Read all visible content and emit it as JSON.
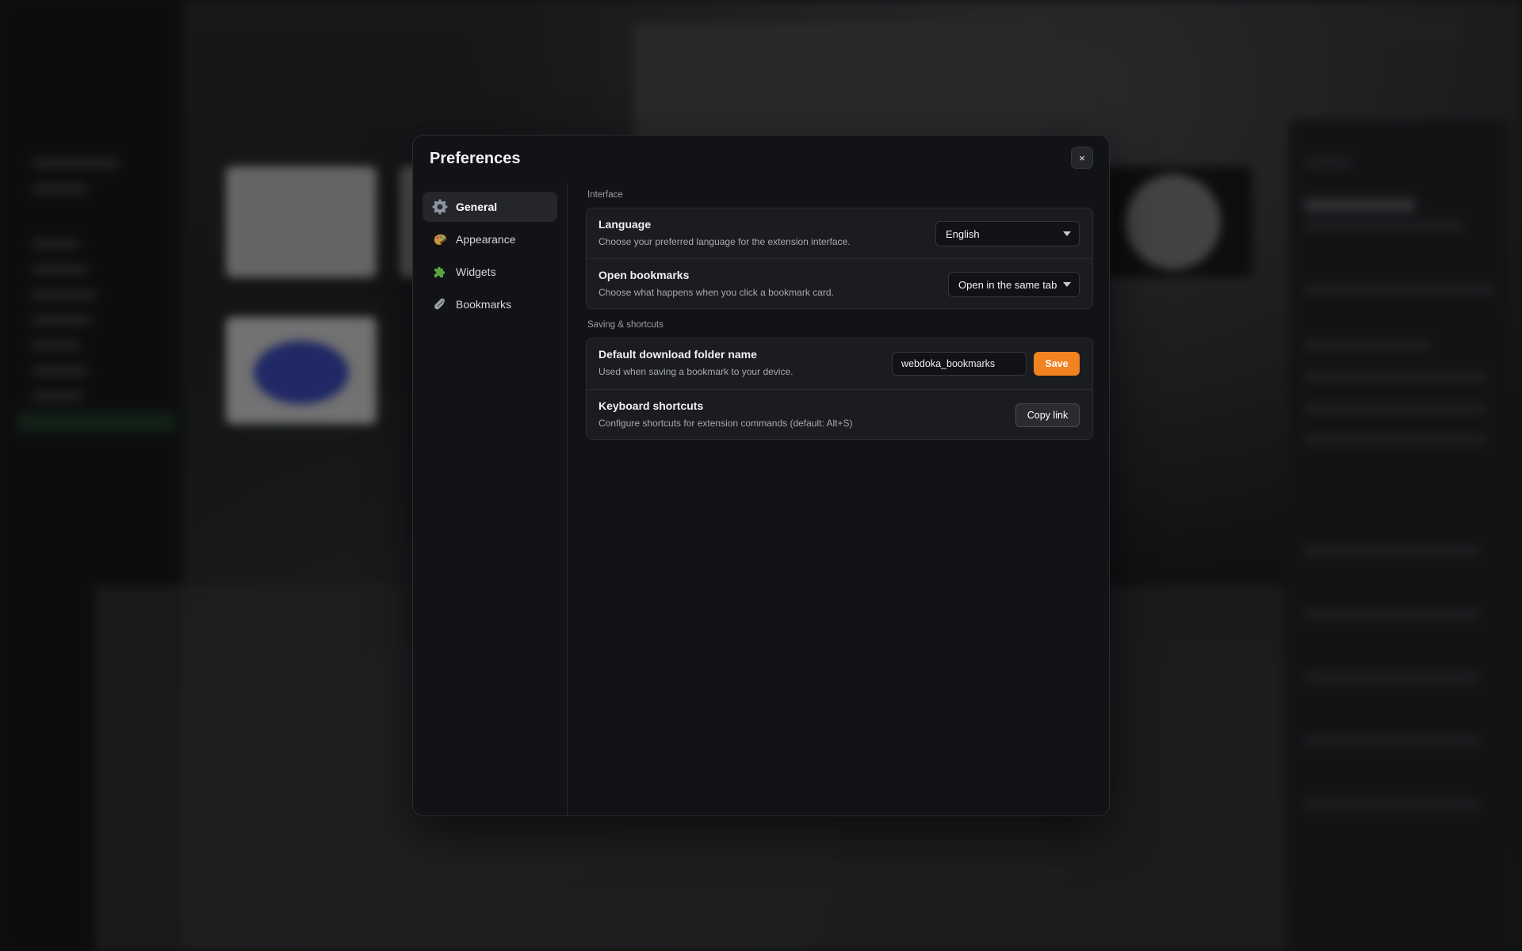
{
  "modal": {
    "title": "Preferences",
    "close_label": "×"
  },
  "sidebar": {
    "items": [
      {
        "label": "General",
        "icon": "gear-icon",
        "active": true
      },
      {
        "label": "Appearance",
        "icon": "palette-icon",
        "active": false
      },
      {
        "label": "Widgets",
        "icon": "puzzle-icon",
        "active": false
      },
      {
        "label": "Bookmarks",
        "icon": "paperclip-icon",
        "active": false
      }
    ]
  },
  "sections": {
    "interface": {
      "label": "Interface",
      "language": {
        "title": "Language",
        "description": "Choose your preferred language for the extension interface.",
        "value": "English"
      },
      "open_bookmarks": {
        "title": "Open bookmarks",
        "description": "Choose what happens when you click a bookmark card.",
        "value": "Open in the same tab"
      }
    },
    "saving": {
      "label": "Saving & shortcuts",
      "download_folder": {
        "title": "Default download folder name",
        "description": "Used when saving a bookmark to your device.",
        "value": "webdoka_bookmarks",
        "button": "Save"
      },
      "shortcuts": {
        "title": "Keyboard shortcuts",
        "description": "Configure shortcuts for extension commands (default: Alt+S)",
        "button": "Copy link"
      }
    }
  },
  "colors": {
    "accent": "#f0821f",
    "modal_bg": "#121316",
    "card_bg": "#1b1c20"
  }
}
